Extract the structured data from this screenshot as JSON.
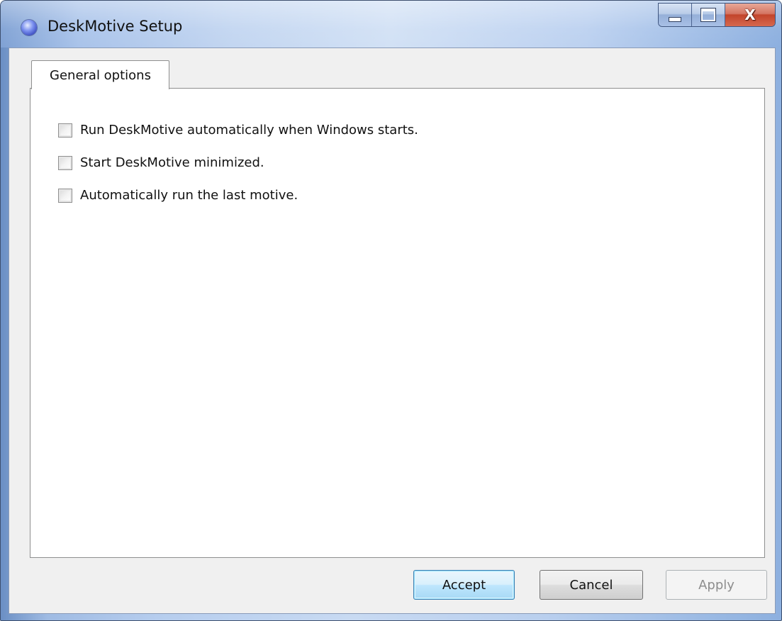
{
  "window": {
    "title": "DeskMotive Setup",
    "icon": "deskmotive-app-icon",
    "close_glyph": "X"
  },
  "tabs": [
    {
      "label": "General options",
      "selected": true
    }
  ],
  "options": [
    {
      "label": "Run DeskMotive automatically when Windows starts.",
      "checked": false
    },
    {
      "label": "Start DeskMotive minimized.",
      "checked": false
    },
    {
      "label": "Automatically run the last motive.",
      "checked": false
    }
  ],
  "buttons": {
    "accept": "Accept",
    "cancel": "Cancel",
    "apply": "Apply"
  },
  "colors": {
    "accent": "#3c7fb1",
    "close": "#c2442b"
  }
}
